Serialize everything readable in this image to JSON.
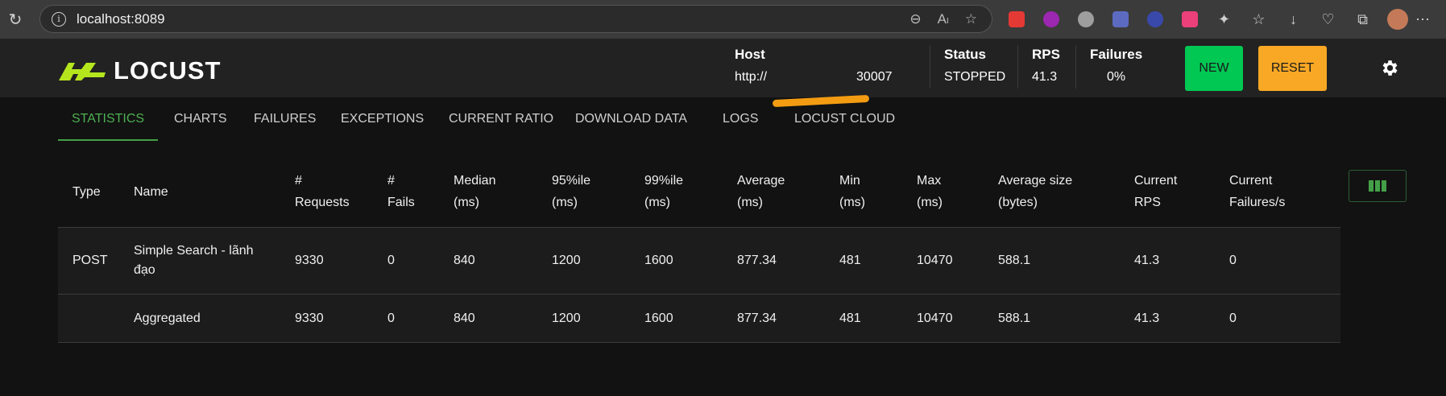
{
  "browser": {
    "url": "localhost:8089"
  },
  "header": {
    "logo_text": "LOCUST",
    "host_label": "Host",
    "host_value": "http://",
    "host_value_suffix": "30007",
    "status_label": "Status",
    "status_value": "STOPPED",
    "rps_label": "RPS",
    "rps_value": "41.3",
    "failures_label": "Failures",
    "failures_value": "0%",
    "new_label": "NEW",
    "reset_label": "RESET"
  },
  "tabs": [
    {
      "label": "STATISTICS",
      "active": true
    },
    {
      "label": "CHARTS"
    },
    {
      "label": "FAILURES"
    },
    {
      "label": "EXCEPTIONS"
    },
    {
      "label": "CURRENT RATIO"
    },
    {
      "label": "DOWNLOAD DATA"
    },
    {
      "label": "LOGS"
    },
    {
      "label": "LOCUST CLOUD"
    }
  ],
  "table": {
    "headers": [
      [
        "Type"
      ],
      [
        "Name"
      ],
      [
        "#",
        "Requests"
      ],
      [
        "#",
        "Fails"
      ],
      [
        "Median",
        "(ms)"
      ],
      [
        "95%ile",
        "(ms)"
      ],
      [
        "99%ile",
        "(ms)"
      ],
      [
        "Average",
        "(ms)"
      ],
      [
        "Min",
        "(ms)"
      ],
      [
        "Max",
        "(ms)"
      ],
      [
        "Average size",
        "(bytes)"
      ],
      [
        "Current",
        "RPS"
      ],
      [
        "Current",
        "Failures/s"
      ]
    ],
    "rows": [
      {
        "type": "POST",
        "name": [
          "Simple Search - lãnh",
          "đạo"
        ],
        "requests": "9330",
        "fails": "0",
        "median": "840",
        "p95": "1200",
        "p99": "1600",
        "average": "877.34",
        "min": "481",
        "max": "10470",
        "avg_size": "588.1",
        "current_rps": "41.3",
        "current_failures": "0"
      },
      {
        "type": "",
        "name": [
          "Aggregated"
        ],
        "requests": "9330",
        "fails": "0",
        "median": "840",
        "p95": "1200",
        "p99": "1600",
        "average": "877.34",
        "min": "481",
        "max": "10470",
        "avg_size": "588.1",
        "current_rps": "41.3",
        "current_failures": "0"
      }
    ]
  },
  "colors": {
    "accent_green": "#4caf50",
    "new_button": "#00c853",
    "reset_button": "#f9a825",
    "logo_green": "#b5e61d"
  }
}
